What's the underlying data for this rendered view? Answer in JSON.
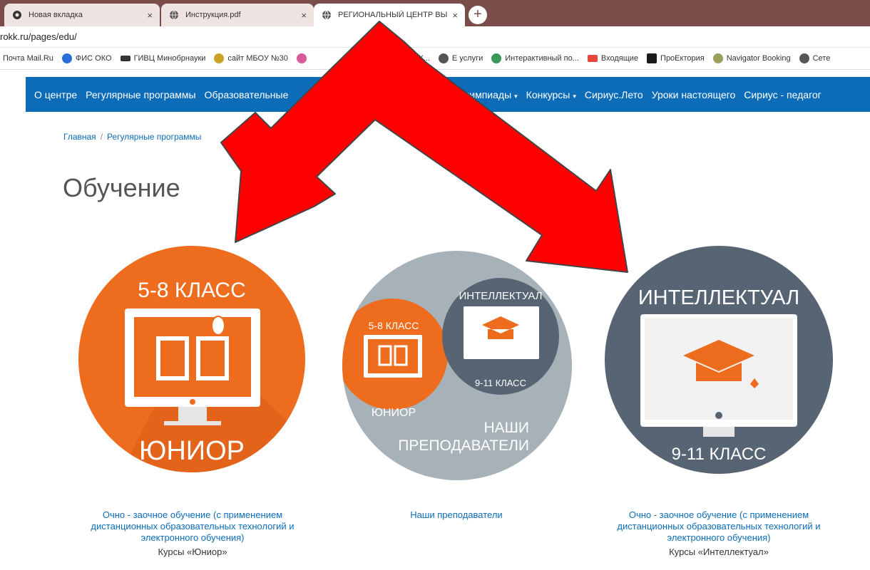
{
  "browser": {
    "tabs": [
      {
        "label": "Новая вкладка",
        "active": false
      },
      {
        "label": "Инструкция.pdf",
        "active": false
      },
      {
        "label": "РЕГИОНАЛЬНЫЙ ЦЕНТР ВЫЯВЛ",
        "active": true
      }
    ],
    "new_tab_label": "+",
    "close_label": "×",
    "url": "rokk.ru/pages/edu/",
    "bookmarks": [
      {
        "label": "Почта Mail.Ru",
        "icon": "mail-icon",
        "color": "#1e6fd0"
      },
      {
        "label": "ФИС ОКО",
        "icon": "fis-icon",
        "color": "#2a6fd6"
      },
      {
        "label": "ГИВЦ Минобрнауки",
        "icon": "bird-icon",
        "color": "#333333"
      },
      {
        "label": "сайт МБОУ №30",
        "icon": "school-icon",
        "color": "#c9a227"
      },
      {
        "label": "",
        "icon": "flower-icon",
        "color": "#d85a9a"
      },
      {
        "label": "бинет К...",
        "icon": "cabinet-icon",
        "color": "#888888"
      },
      {
        "label": "Е услуги",
        "icon": "globe-icon",
        "color": "#555555"
      },
      {
        "label": "Интерактивный по...",
        "icon": "interactive-icon",
        "color": "#3a9a5a"
      },
      {
        "label": "Входящие",
        "icon": "gmail-icon",
        "color": "#e8453c"
      },
      {
        "label": "ПроЕктория",
        "icon": "proektoria-icon",
        "color": "#1b1b1b"
      },
      {
        "label": "Navigator Booking",
        "icon": "navigator-icon",
        "color": "#9aa05a"
      },
      {
        "label": "Сете",
        "icon": "globe-icon",
        "color": "#555555"
      }
    ]
  },
  "nav": {
    "items": [
      {
        "label": "О центре",
        "dropdown": false
      },
      {
        "label": "Регулярные программы",
        "dropdown": false
      },
      {
        "label": "Образовательные",
        "dropdown": false
      },
      {
        "label": "Олимпиады",
        "dropdown": true
      },
      {
        "label": "Конкурсы",
        "dropdown": true
      },
      {
        "label": "Сириус.Лето",
        "dropdown": false
      },
      {
        "label": "Уроки настоящего",
        "dropdown": false
      },
      {
        "label": "Сириус - педагог",
        "dropdown": false
      }
    ]
  },
  "breadcrumb": {
    "home": "Главная",
    "separator": "/",
    "current": "Регулярные программы"
  },
  "page_title": "Обучение",
  "cards": [
    {
      "top_text": "5-8 КЛАСС",
      "bottom_text": "ЮНИОР",
      "link": [
        "Очно - заочное обучение (с применением",
        "дистанционных образовательных технологий и",
        "электронного обучения)"
      ],
      "subtitle": "Курсы «Юниор»",
      "color": "#ee6c1d"
    },
    {
      "small_left_top": "5-8 КЛАСС",
      "small_left_bottom": "ЮНИОР",
      "small_right_top": "ИНТЕЛЛЕКТУАЛ",
      "small_right_bottom": "9-11 КЛАСС",
      "bottom_line1": "НАШИ",
      "bottom_line2": "ПРЕПОДАВАТЕЛИ",
      "link": [
        "Наши преподаватели"
      ],
      "color": "#a6b1b8"
    },
    {
      "top_text": "ИНТЕЛЛЕКТУАЛ",
      "bottom_text": "9-11 КЛАСС",
      "link": [
        "Очно - заочное  обучение (с применением",
        "дистанционных образовательных технологий и",
        "электронного обучения)"
      ],
      "subtitle": "Курсы  «Интеллектуал»",
      "color": "#576474"
    }
  ],
  "colors": {
    "arrow": "#ff0000",
    "nav": "#0c6cb7",
    "tabbar": "#7b4d4a"
  }
}
